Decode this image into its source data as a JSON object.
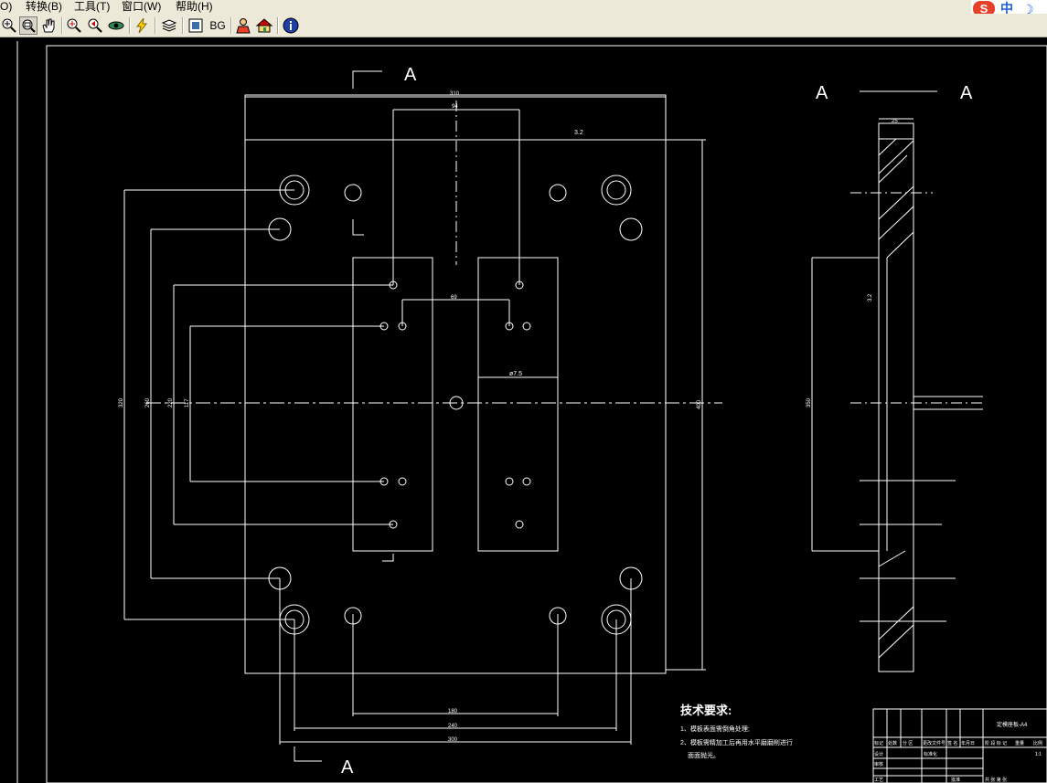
{
  "menubar": {
    "items": [
      {
        "label": "O)"
      },
      {
        "label": "转换(B)"
      },
      {
        "label": "工具(T)"
      },
      {
        "label": "窗口(W)"
      },
      {
        "label": "帮助(H)"
      }
    ]
  },
  "toolbar": {
    "buttons": [
      {
        "name": "zoom-in",
        "icon": "magnifier-plus-icon"
      },
      {
        "name": "zoom-window",
        "icon": "magnifier-window-icon",
        "active": true
      },
      {
        "name": "pan",
        "icon": "hand-icon"
      },
      {
        "name": "zoom-realtime",
        "icon": "magnifier-realtime-icon"
      },
      {
        "name": "zoom-previous",
        "icon": "magnifier-previous-icon"
      },
      {
        "name": "view-3d",
        "icon": "eye-icon"
      },
      {
        "name": "regen",
        "icon": "lightning-icon"
      },
      {
        "name": "layers",
        "icon": "layers-icon"
      },
      {
        "name": "frame",
        "icon": "frame-icon"
      },
      {
        "name": "background",
        "label": "BG"
      },
      {
        "name": "user",
        "icon": "user-icon"
      },
      {
        "name": "home",
        "icon": "home-icon"
      },
      {
        "name": "about",
        "icon": "info-icon"
      }
    ]
  },
  "ime": {
    "mode": "中",
    "colors": {
      "brand": "#e8412a",
      "accent": "#1e5fd8"
    }
  },
  "drawing": {
    "section_label": "A",
    "dims": {
      "overall_width": "310",
      "slot_width": "94",
      "bottom_inner": "180",
      "bottom_mid": "240",
      "bottom_outer": "300",
      "center_gap": "69",
      "slot_depth": "ø7.5",
      "left_outer": "320",
      "left_mid": "260",
      "left_inner": "220",
      "left_small": "117",
      "right_height": "400",
      "roughness": "3.2",
      "side_thickness": "25",
      "side_slot": "350"
    },
    "tech_title": "技术要求:",
    "tech_lines": [
      "1、模板表面需倒角处理;",
      "2、模板需精加工后再用水平磨磨削进行",
      "面面抛光。"
    ],
    "title_block": {
      "part_name": "定模座板-A4",
      "header_cells": [
        "标记",
        "处数",
        "分 区",
        "更改文件号",
        "签 名",
        "年月日"
      ],
      "rows": [
        "设计",
        "审核",
        "工艺"
      ],
      "cell_std": "标准化",
      "cell_approve": "批准",
      "cell_stage": "阶 段 标 记",
      "cell_weight": "重量",
      "cell_scale": "比例",
      "scale_value": "1:1",
      "cell_sheet": "共 张 第 张"
    },
    "colors": {
      "background": "#000000",
      "line": "#ffffff"
    }
  }
}
